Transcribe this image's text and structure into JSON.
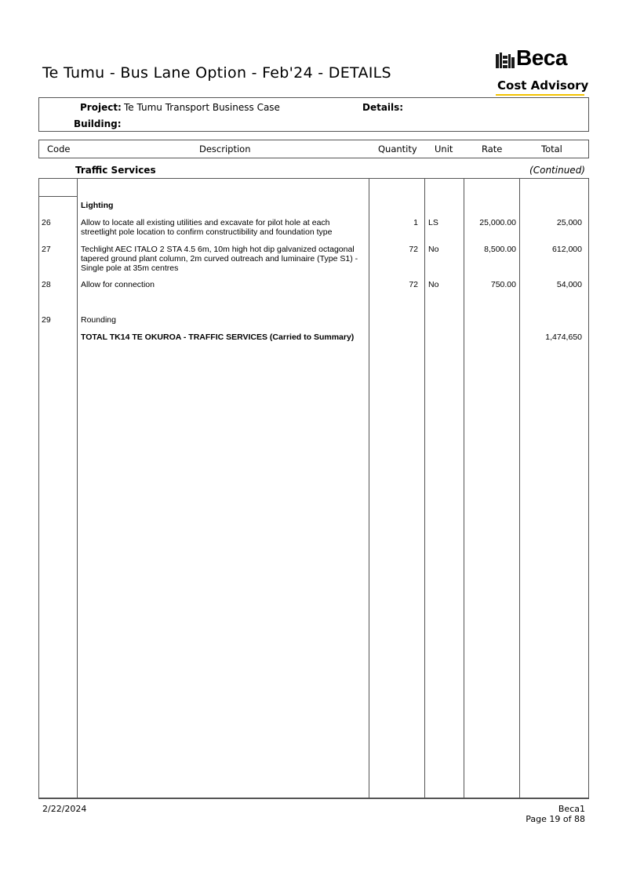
{
  "page": {
    "title": "Te Tumu - Bus Lane Option - Feb'24 - DETAILS"
  },
  "logo": {
    "word": "Beca",
    "subtitle": "Cost Advisory",
    "icon": "beca-building-icon",
    "accent_color": "#f2c200"
  },
  "project": {
    "project_label": "Project:",
    "project_value": "Te Tumu Transport Business Case",
    "details_label": "Details:",
    "building_label": "Building:"
  },
  "table": {
    "headers": {
      "code": "Code",
      "description": "Description",
      "quantity": "Quantity",
      "unit": "Unit",
      "rate": "Rate",
      "total": "Total"
    },
    "section": "Traffic Services",
    "continued": "(Continued)",
    "subheading": "Lighting",
    "rows": [
      {
        "code": "26",
        "description": "Allow to locate all existing utilities and excavate for pilot hole at each streetlight pole location to confirm constructibility and foundation type",
        "quantity": "1",
        "unit": "LS",
        "rate": "25,000.00",
        "total": "25,000"
      },
      {
        "code": "27",
        "description": "Techlight AEC ITALO 2 STA 4.5 6m, 10m high hot dip galvanized octagonal tapered ground plant column, 2m curved outreach and luminaire (Type S1) - Single pole at 35m centres",
        "quantity": "72",
        "unit": "No",
        "rate": "8,500.00",
        "total": "612,000"
      },
      {
        "code": "28",
        "description": "Allow for connection",
        "quantity": "72",
        "unit": "No",
        "rate": "750.00",
        "total": "54,000"
      },
      {
        "code": "29",
        "description": "Rounding",
        "quantity": "",
        "unit": "",
        "rate": "",
        "total": ""
      }
    ],
    "total_row": {
      "description": "TOTAL TK14 TE OKUROA - TRAFFIC SERVICES (Carried to Summary)",
      "total": "1,474,650"
    }
  },
  "footer": {
    "date": "2/22/2024",
    "company": "Beca1",
    "page": "Page 19 of 88"
  }
}
